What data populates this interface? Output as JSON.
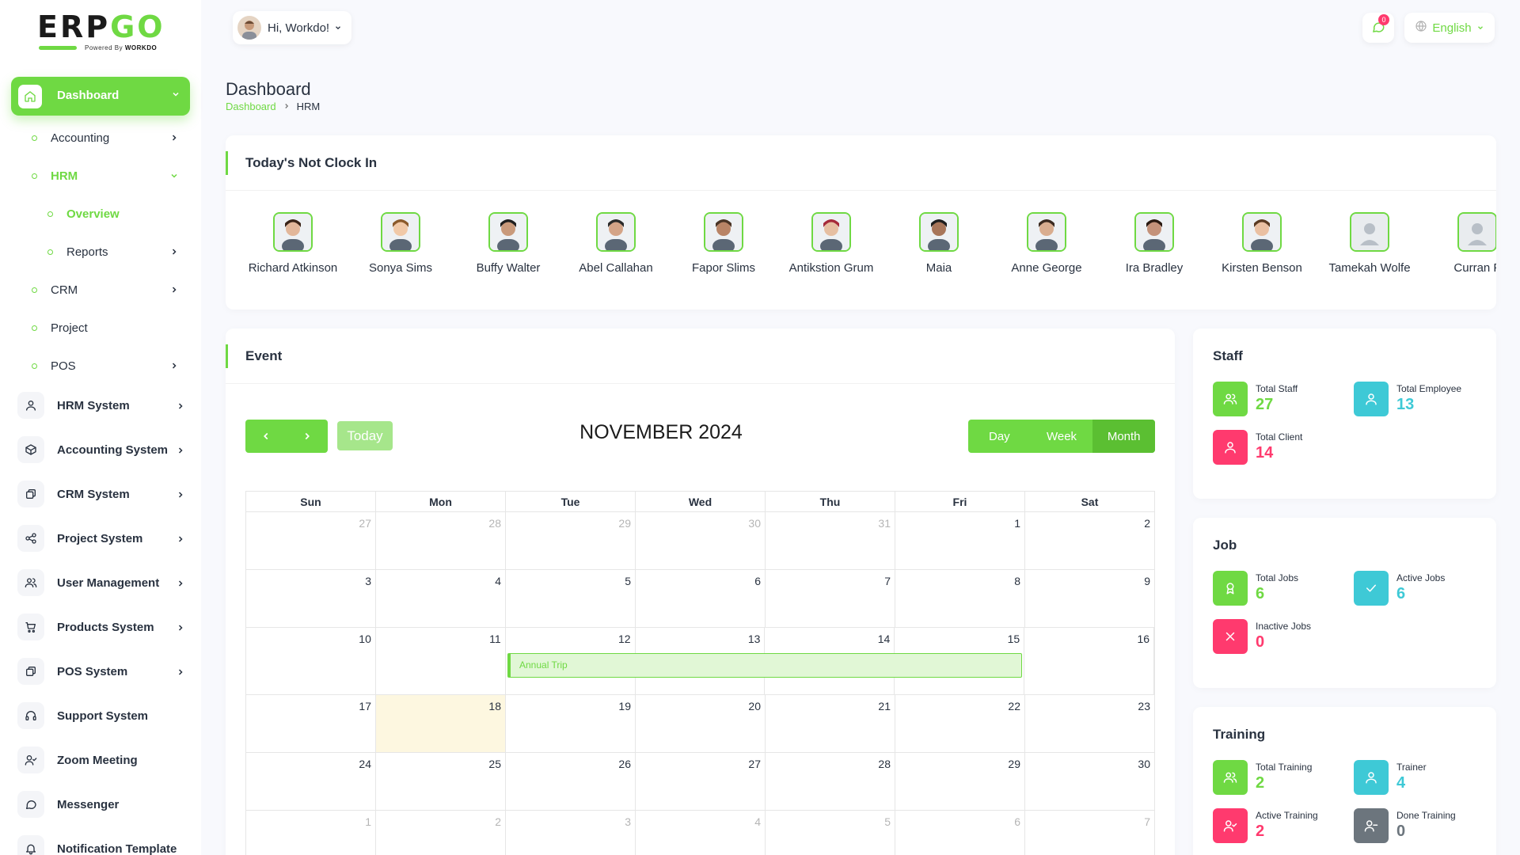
{
  "brand": {
    "logo_main": "ERP",
    "logo_accent": "GO",
    "powered_prefix": "Powered By",
    "powered_name": "WORKDO"
  },
  "sidebar": {
    "active_item": "Dashboard",
    "sub_items": [
      {
        "label": "Accounting",
        "has_chevron": true
      },
      {
        "label": "HRM",
        "has_chevron": true,
        "expanded": true
      },
      {
        "label": "Overview",
        "has_chevron": false
      },
      {
        "label": "Reports",
        "has_chevron": true
      },
      {
        "label": "CRM",
        "has_chevron": true
      },
      {
        "label": "Project",
        "has_chevron": false
      },
      {
        "label": "POS",
        "has_chevron": true
      }
    ],
    "systems": [
      {
        "label": "HRM System",
        "icon": "user-icon",
        "has_chevron": true
      },
      {
        "label": "Accounting System",
        "icon": "box-icon",
        "has_chevron": true
      },
      {
        "label": "CRM System",
        "icon": "layers-icon",
        "has_chevron": true
      },
      {
        "label": "Project System",
        "icon": "share-icon",
        "has_chevron": true
      },
      {
        "label": "User Management",
        "icon": "users-icon",
        "has_chevron": true
      },
      {
        "label": "Products System",
        "icon": "cart-icon",
        "has_chevron": true
      },
      {
        "label": "POS System",
        "icon": "layers-icon",
        "has_chevron": true
      },
      {
        "label": "Support System",
        "icon": "headset-icon",
        "has_chevron": false
      },
      {
        "label": "Zoom Meeting",
        "icon": "user-check-icon",
        "has_chevron": false
      },
      {
        "label": "Messenger",
        "icon": "message-icon",
        "has_chevron": false
      },
      {
        "label": "Notification Template",
        "icon": "bell-icon",
        "has_chevron": false
      }
    ]
  },
  "header": {
    "greeting": "Hi, Workdo!",
    "notification_count": "0",
    "language": "English"
  },
  "page": {
    "title": "Dashboard",
    "breadcrumb": [
      "Dashboard",
      "HRM"
    ]
  },
  "not_clock_in": {
    "title": "Today's Not Clock In",
    "employees": [
      {
        "name": "Richard Atkinson",
        "has_photo": true
      },
      {
        "name": "Sonya Sims",
        "has_photo": true
      },
      {
        "name": "Buffy Walter",
        "has_photo": true
      },
      {
        "name": "Abel Callahan",
        "has_photo": true
      },
      {
        "name": "Fapor Slims",
        "has_photo": true
      },
      {
        "name": "Antikstion Grum",
        "has_photo": true
      },
      {
        "name": "Maia",
        "has_photo": true
      },
      {
        "name": "Anne George",
        "has_photo": true
      },
      {
        "name": "Ira Bradley",
        "has_photo": true
      },
      {
        "name": "Kirsten Benson",
        "has_photo": true
      },
      {
        "name": "Tamekah Wolfe",
        "has_photo": false
      },
      {
        "name": "Curran F",
        "has_photo": false
      }
    ]
  },
  "event": {
    "title": "Event",
    "today_label": "Today",
    "month_title": "NOVEMBER 2024",
    "views": [
      "Day",
      "Week",
      "Month"
    ],
    "active_view": "Month",
    "weekdays": [
      "Sun",
      "Mon",
      "Tue",
      "Wed",
      "Thu",
      "Fri",
      "Sat"
    ],
    "weeks": [
      [
        "27",
        "28",
        "29",
        "30",
        "31",
        "1",
        "2"
      ],
      [
        "3",
        "4",
        "5",
        "6",
        "7",
        "8",
        "9"
      ],
      [
        "10",
        "11",
        "12",
        "13",
        "14",
        "15",
        "16"
      ],
      [
        "17",
        "18",
        "19",
        "20",
        "21",
        "22",
        "23"
      ],
      [
        "24",
        "25",
        "26",
        "27",
        "28",
        "29",
        "30"
      ],
      [
        "1",
        "2",
        "3",
        "4",
        "5",
        "6",
        "7"
      ]
    ],
    "today_date": "18",
    "event_name": "Annual Trip",
    "event_start_day": "12",
    "event_end_day": "15"
  },
  "staff": {
    "title": "Staff",
    "stats": [
      {
        "label": "Total Staff",
        "value": "27",
        "color": "#6fd943",
        "icon": "users-icon"
      },
      {
        "label": "Total Employee",
        "value": "13",
        "color": "#3ec9d6",
        "icon": "user-icon"
      },
      {
        "label": "Total Client",
        "value": "14",
        "color": "#ff3a6e",
        "icon": "user-icon"
      }
    ]
  },
  "job": {
    "title": "Job",
    "stats": [
      {
        "label": "Total Jobs",
        "value": "6",
        "color": "#6fd943",
        "icon": "award-icon"
      },
      {
        "label": "Active Jobs",
        "value": "6",
        "color": "#3ec9d6",
        "icon": "check-icon"
      },
      {
        "label": "Inactive Jobs",
        "value": "0",
        "color": "#ff3a6e",
        "icon": "x-icon"
      }
    ]
  },
  "training": {
    "title": "Training",
    "stats": [
      {
        "label": "Total Training",
        "value": "2",
        "color": "#6fd943",
        "icon": "users-icon"
      },
      {
        "label": "Trainer",
        "value": "4",
        "color": "#3ec9d6",
        "icon": "user-icon"
      },
      {
        "label": "Active Training",
        "value": "2",
        "color": "#ff3a6e",
        "icon": "user-check-icon"
      },
      {
        "label": "Done Training",
        "value": "0",
        "color": "#6c757d",
        "icon": "user-minus-icon"
      }
    ]
  }
}
